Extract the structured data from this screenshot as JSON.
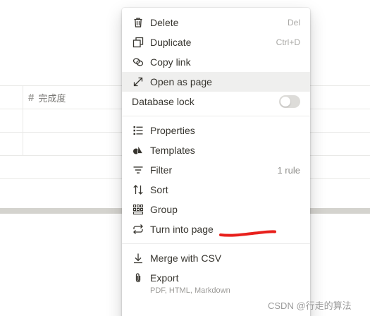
{
  "table": {
    "column_header": "完成度"
  },
  "menu": {
    "items": [
      {
        "label": "Delete",
        "shortcut": "Del",
        "icon": "trash-icon"
      },
      {
        "label": "Duplicate",
        "shortcut": "Ctrl+D",
        "icon": "duplicate-icon"
      },
      {
        "label": "Copy link",
        "icon": "link-icon"
      },
      {
        "label": "Open as page",
        "icon": "expand-arrow-icon",
        "hovered": true
      },
      {
        "label": "Database lock",
        "icon": "",
        "toggle": false
      },
      {
        "label": "Properties",
        "icon": "list-icon"
      },
      {
        "label": "Templates",
        "icon": "shapes-icon"
      },
      {
        "label": "Filter",
        "hint": "1 rule",
        "icon": "filter-icon"
      },
      {
        "label": "Sort",
        "icon": "sort-arrows-icon"
      },
      {
        "label": "Group",
        "icon": "grid-icon"
      },
      {
        "label": "Turn into page",
        "icon": "cycle-arrows-icon"
      },
      {
        "label": "Merge with CSV",
        "icon": "download-arrow-icon"
      },
      {
        "label": "Export",
        "sub": "PDF, HTML, Markdown",
        "icon": "paperclip-icon"
      }
    ]
  },
  "watermark": "CSDN @行走的算法",
  "colors": {
    "annotation": "#e8201c",
    "hover": "#efefee"
  }
}
